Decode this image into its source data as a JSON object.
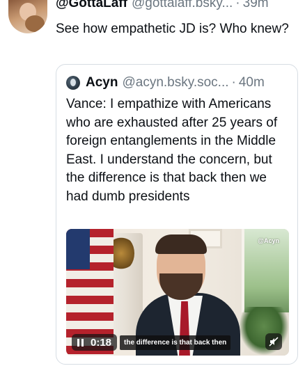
{
  "post": {
    "author_name": "@GottaLaff",
    "author_handle": "@gottalaff.bsky...",
    "separator": "·",
    "timestamp": "39m",
    "text": "See how empathetic JD is? Who knew?"
  },
  "quote": {
    "author_name": "Acyn",
    "author_handle": "@acyn.bsky.soc...",
    "separator": "·",
    "timestamp": "40m",
    "text": "Vance: I empathize with Americans who are exhausted after 25 years of foreign entanglements in the Middle East. I understand the concern, but the difference is that back then we had dumb presidents"
  },
  "video": {
    "watermark": "@Acyn",
    "elapsed": "0:18",
    "caption": "the difference is that back then",
    "pause_icon": "pause-icon",
    "mute_icon": "mute-icon"
  }
}
